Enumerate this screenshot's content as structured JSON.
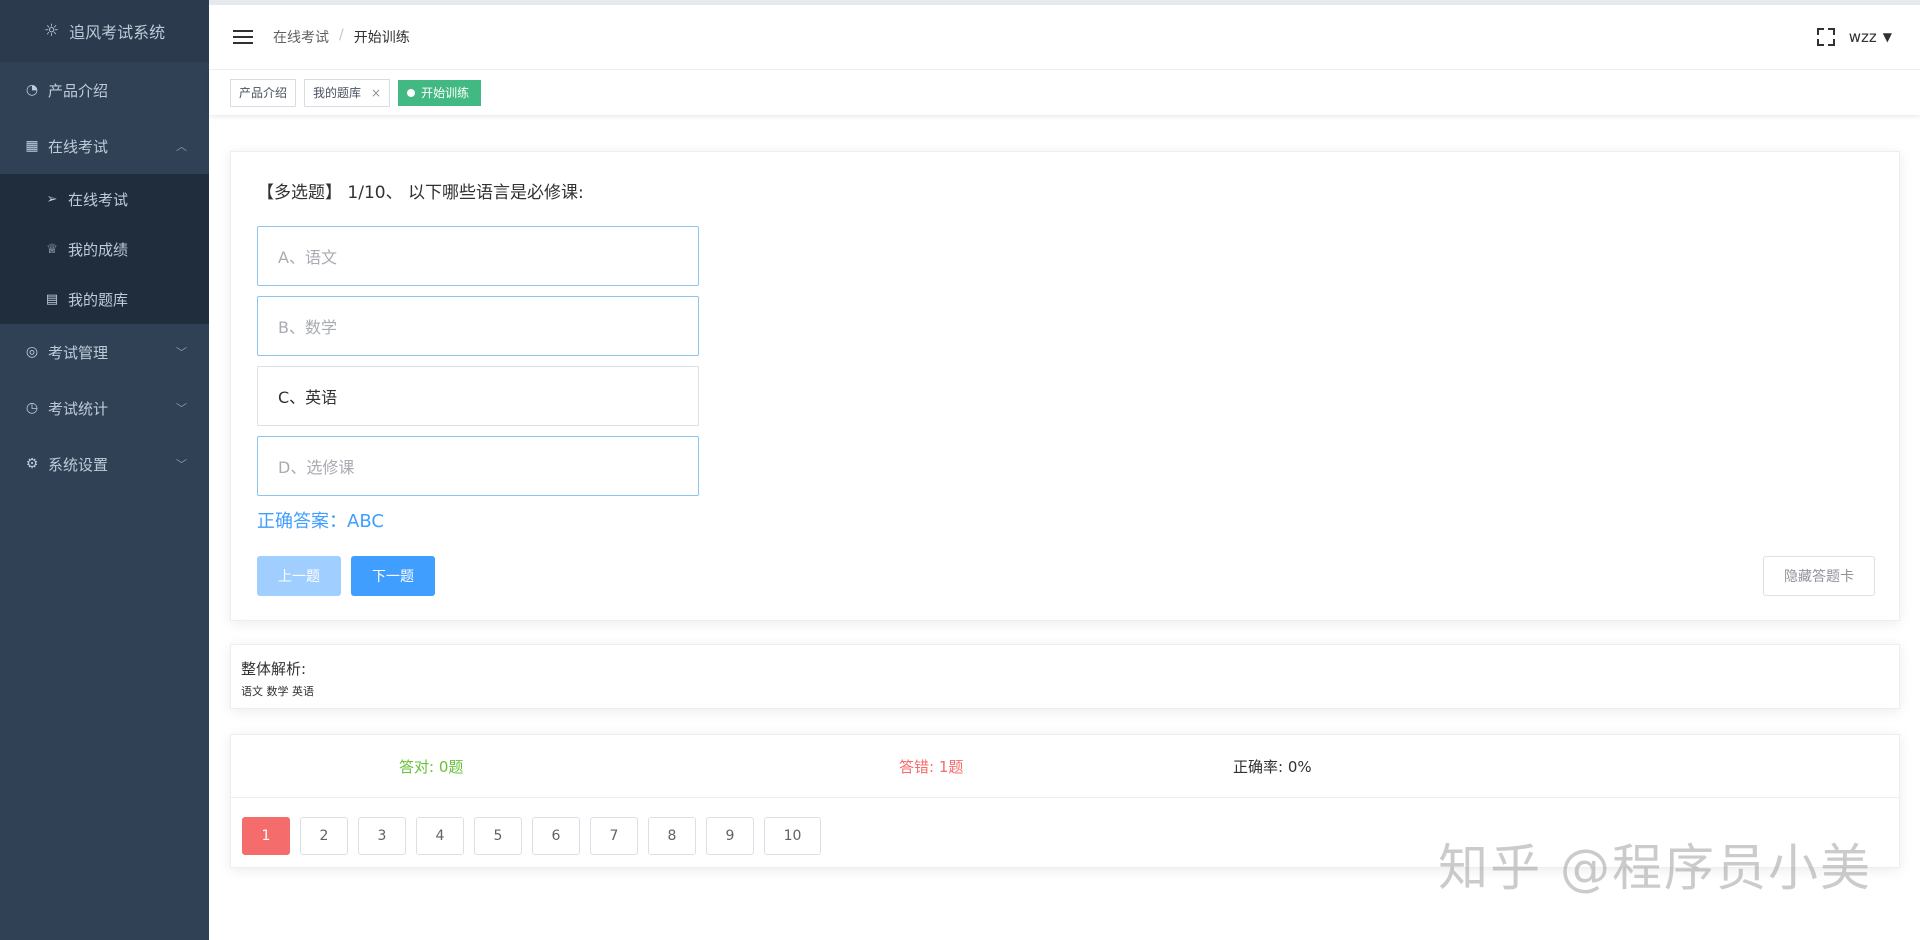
{
  "app": {
    "title": "追风考试系统"
  },
  "sidebar": {
    "items": [
      {
        "label": "产品介绍",
        "icon": "dashboard-icon"
      },
      {
        "label": "在线考试",
        "icon": "grid-icon",
        "open": true,
        "children": [
          {
            "label": "在线考试",
            "icon": "paper-plane-icon"
          },
          {
            "label": "我的成绩",
            "icon": "trophy-icon"
          },
          {
            "label": "我的题库",
            "icon": "list-icon"
          }
        ]
      },
      {
        "label": "考试管理",
        "icon": "lifebuoy-icon"
      },
      {
        "label": "考试统计",
        "icon": "pie-chart-icon"
      },
      {
        "label": "系统设置",
        "icon": "gear-icon"
      }
    ]
  },
  "header": {
    "breadcrumb": [
      "在线考试",
      "开始训练"
    ],
    "user": "wzz"
  },
  "tags": [
    {
      "label": "产品介绍"
    },
    {
      "label": "我的题库",
      "closable": true
    },
    {
      "label": "开始训练",
      "active": true
    }
  ],
  "question": {
    "title": "【多选题】 1/10、 以下哪些语言是必修课:",
    "options": [
      "A、语文",
      "B、数学",
      "C、英语",
      "D、选修课"
    ],
    "answer": "正确答案：ABC",
    "prev_label": "上一题",
    "next_label": "下一题",
    "hide_label": "隐藏答题卡"
  },
  "analysis": {
    "title": "整体解析:",
    "text": "语文 数学 英语"
  },
  "stats": {
    "correct": "答对: 0题",
    "wrong": "答错: 1题",
    "rate": "正确率: 0%"
  },
  "pager": [
    "1",
    "2",
    "3",
    "4",
    "5",
    "6",
    "7",
    "8",
    "9",
    "10"
  ],
  "watermark": "知乎 @程序员小美",
  "colors": {
    "sidebar_bg": "#304156",
    "accent": "#409eff",
    "active_tag": "#42b983",
    "correct": "#67c23a",
    "wrong": "#f56c6c"
  }
}
